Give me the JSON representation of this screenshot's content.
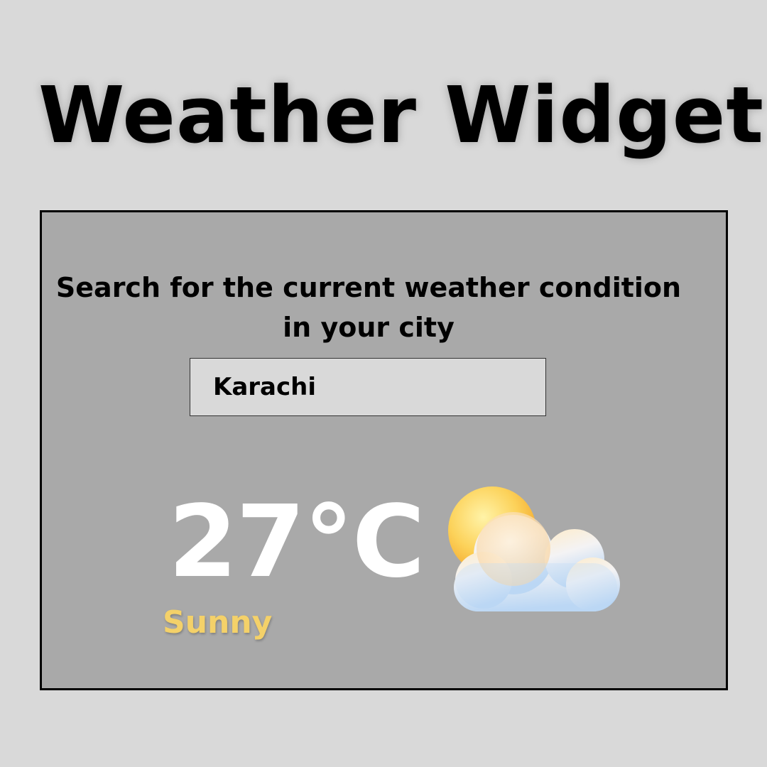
{
  "header": {
    "title": "Weather Widget"
  },
  "widget": {
    "prompt_line1": "Search for the current weather condition",
    "prompt_line2": "in your city",
    "search": {
      "value": "Karachi",
      "placeholder": ""
    },
    "temperature": "27°C",
    "condition": "Sunny",
    "icon": "sun-behind-cloud-icon"
  },
  "colors": {
    "background": "#d9d9d9",
    "widget_background": "#a9a9a9",
    "temperature": "#ffffff",
    "condition": "#f4d169"
  }
}
